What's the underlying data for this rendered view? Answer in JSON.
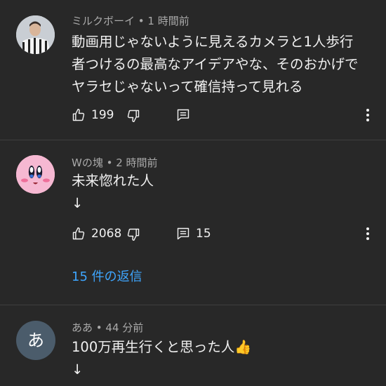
{
  "comments": [
    {
      "author": "ミルクボーイ",
      "time": "1 時間前",
      "text": "動画用じゃないように見えるカメラと1人歩行\n者つけるの最高なアイデアやな、そのおかげで\nヤラセじゃないって確信持って見れる",
      "likes": "199",
      "reply_count": "",
      "avatar_icon": "player-photo-avatar"
    },
    {
      "author": "Wの塊",
      "time": "2 時間前",
      "text": "未来惚れた人\n↓",
      "likes": "2068",
      "reply_count": "15",
      "avatar_icon": "kirby-face-avatar",
      "replies_label": "15 件の返信"
    },
    {
      "author": "ああ",
      "time": "44 分前",
      "text": "100万再生行くと思った人👍\n↓",
      "avatar_letter": "あ",
      "avatar_color": "#4b5c6b"
    }
  ],
  "separator": " • ",
  "colors": {
    "background": "#282828",
    "text": "#f1f1f1",
    "meta": "#aaaaaa",
    "link": "#3ea6ff",
    "divider": "#3f3f3f"
  }
}
